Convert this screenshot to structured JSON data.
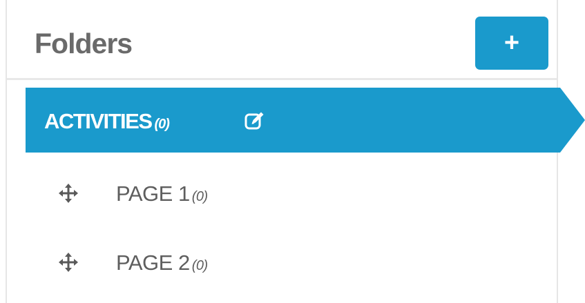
{
  "panel": {
    "title": "Folders",
    "add_button_label": "+"
  },
  "folders": [
    {
      "label": "ACTIVITIES",
      "count": "(0)",
      "active": true,
      "icon": "edit-icon",
      "pages": [
        {
          "label": "PAGE 1",
          "count": "(0)",
          "icon": "move-icon"
        },
        {
          "label": "PAGE 2",
          "count": "(0)",
          "icon": "move-icon"
        }
      ]
    }
  ],
  "colors": {
    "accent": "#1a9acc",
    "title_text": "#6a6a6a",
    "item_text": "#5e5e5e",
    "border": "#e6e6e6"
  }
}
